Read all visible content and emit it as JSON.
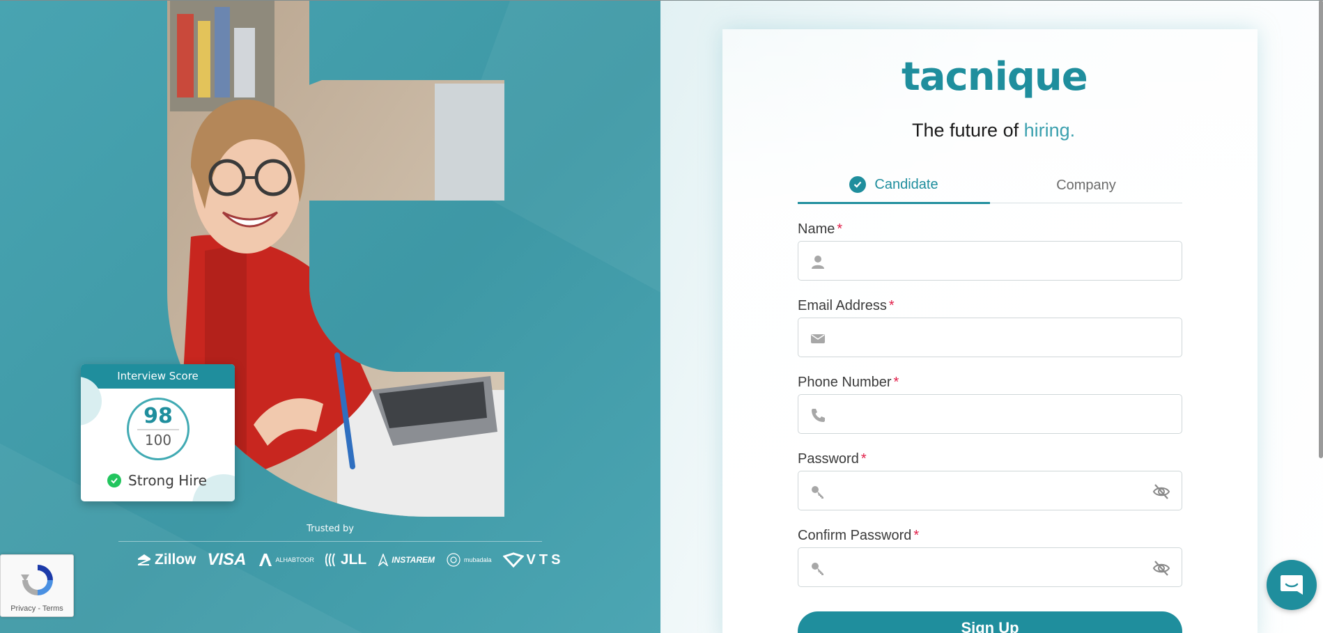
{
  "hero": {
    "score_card": {
      "title": "Interview Score",
      "score": "98",
      "out_of": "100",
      "verdict": "Strong Hire"
    },
    "trusted_by": "Trusted by",
    "logos": [
      "Zillow",
      "VISA",
      "ALHABTOOR",
      "JLL",
      "INSTAREM",
      "mubadala",
      "VTS"
    ],
    "recaptcha": "Privacy - Terms"
  },
  "brand": {
    "name": "tacnique",
    "tagline_prefix": "The future of ",
    "tagline_accent": "hiring."
  },
  "tabs": [
    {
      "label": "Candidate",
      "active": true
    },
    {
      "label": "Company",
      "active": false
    }
  ],
  "form": {
    "name_label": "Name",
    "email_label": "Email Address",
    "phone_label": "Phone Number",
    "password_label": "Password",
    "confirm_label": "Confirm Password",
    "required_mark": "*",
    "submit_label": "Sign Up"
  },
  "icons": {
    "name": "user-icon",
    "email": "envelope-icon",
    "phone": "phone-icon",
    "password": "key-icon",
    "toggle": "eye-slash-icon",
    "chat": "chat-icon"
  },
  "colors": {
    "brand": "#1f8e9d",
    "hero_bg": "#41a0ae",
    "required": "#e11d48",
    "success": "#22c55e"
  }
}
